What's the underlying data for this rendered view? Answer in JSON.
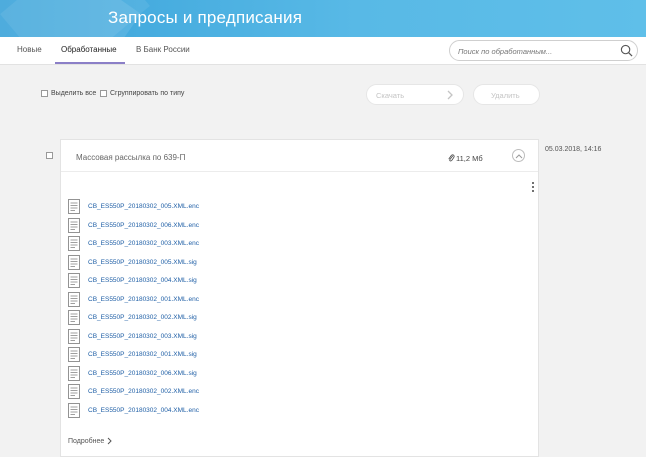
{
  "header": {
    "title": "Запросы и предписания",
    "bg_color": "#4fb2e2"
  },
  "tabs": [
    {
      "label": "Новые"
    },
    {
      "label": "Обработанные",
      "active": true
    },
    {
      "label": "В Банк России"
    }
  ],
  "search": {
    "placeholder": "Поиск по обработанным..."
  },
  "toolbar": {
    "select_all_label": "Выделить все",
    "group_by_type_label": "Сгруппировать по типу",
    "download_label": "Скачать",
    "delete_label": "Удалить"
  },
  "message": {
    "title": "Массовая рассылка по 639-П",
    "size": "11,2 Мб",
    "date": "05.03.2018, 14:16",
    "files": [
      "CB_ES550P_20180302_005.XML.enc",
      "CB_ES550P_20180302_006.XML.enc",
      "CB_ES550P_20180302_003.XML.enc",
      "CB_ES550P_20180302_005.XML.sig",
      "CB_ES550P_20180302_004.XML.sig",
      "CB_ES550P_20180302_001.XML.enc",
      "CB_ES550P_20180302_002.XML.sig",
      "CB_ES550P_20180302_003.XML.sig",
      "CB_ES550P_20180302_001.XML.sig",
      "CB_ES550P_20180302_006.XML.sig",
      "CB_ES550P_20180302_002.XML.enc",
      "CB_ES550P_20180302_004.XML.enc"
    ],
    "more_label": "Подробнее"
  }
}
